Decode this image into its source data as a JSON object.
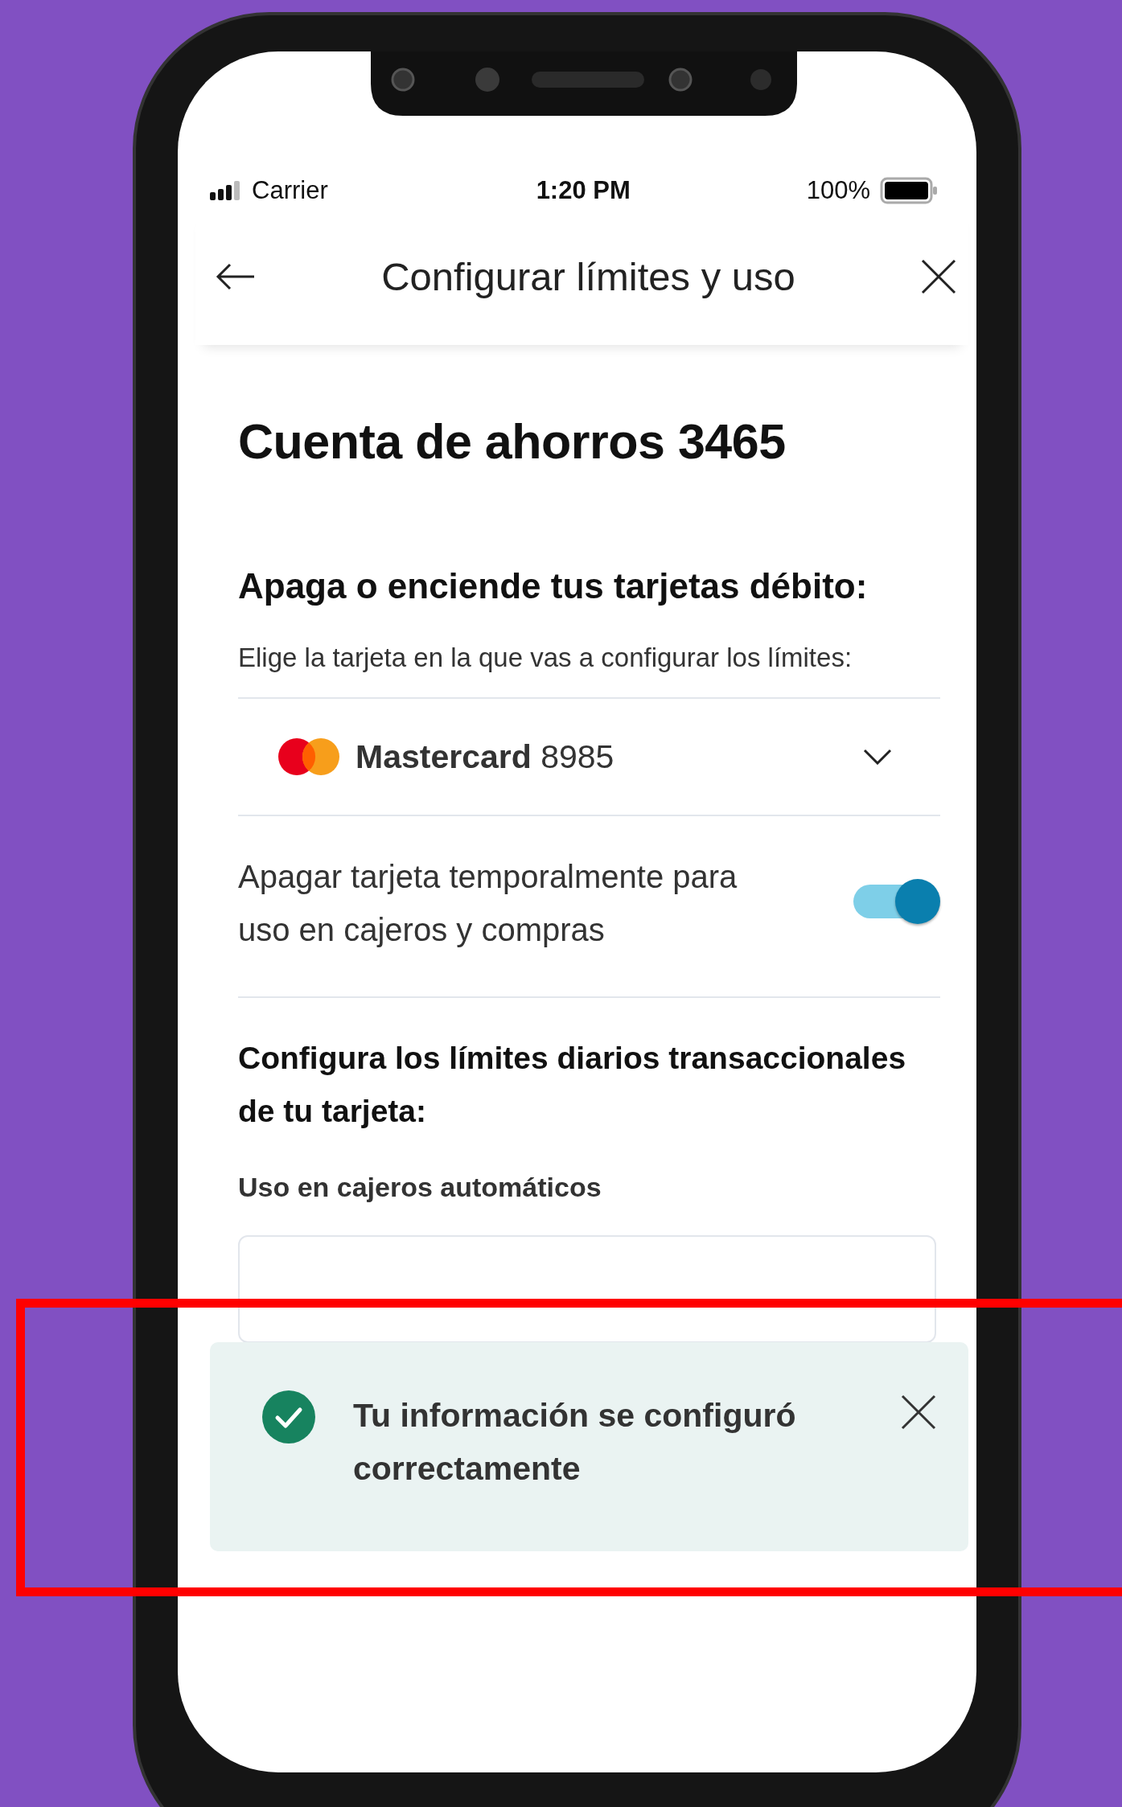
{
  "status_bar": {
    "carrier": "Carrier",
    "time": "1:20 PM",
    "battery": "100%"
  },
  "header": {
    "title": "Configurar límites y uso"
  },
  "account_title": "Cuenta de ahorros 3465",
  "debit_section": {
    "heading": "Apaga o enciende tus tarjetas débito:",
    "instruction": "Elige la tarjeta en la que vas a configurar los límites:",
    "card_selector": {
      "brand": "Mastercard",
      "number": "8985"
    },
    "toggle": {
      "label": "Apagar tarjeta temporalmente para uso en cajeros y compras",
      "on": true
    }
  },
  "limits_section": {
    "heading": "Configura los límites diarios transaccionales de tu tarjeta:",
    "atm_label": "Uso en cajeros automáticos"
  },
  "toast": {
    "message": "Tu información se configuró correctamente"
  }
}
